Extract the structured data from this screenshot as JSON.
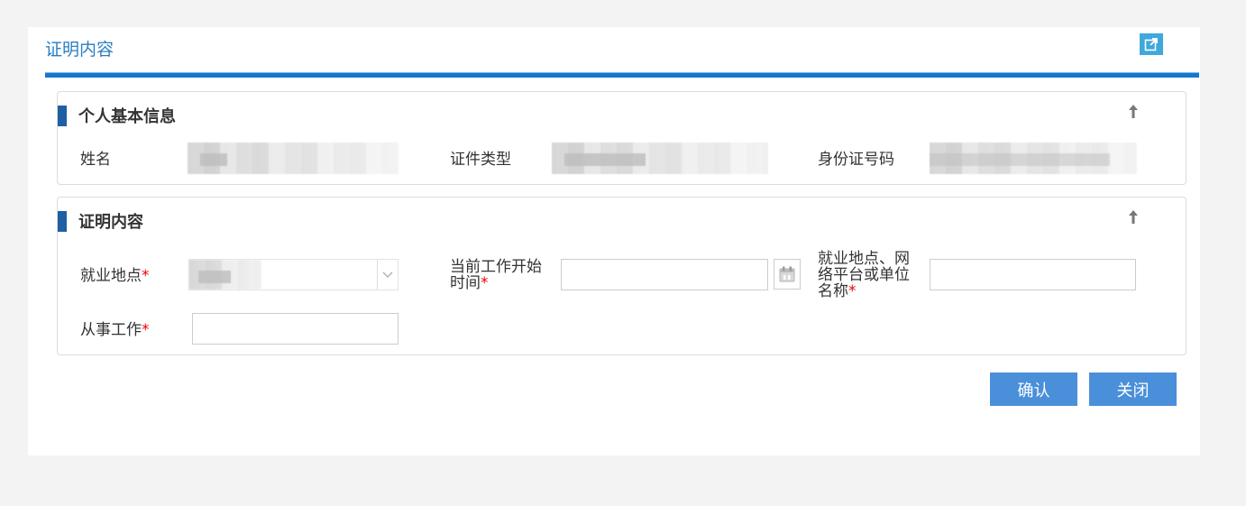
{
  "window": {
    "title": "证明内容"
  },
  "section_personal": {
    "title": "个人基本信息",
    "fields": {
      "name_label": "姓名",
      "id_type_label": "证件类型",
      "id_number_label": "身份证号码"
    }
  },
  "section_proof": {
    "title": "证明内容",
    "fields": {
      "location_label": "就业地点",
      "start_time_label_line1": "当前工作开始",
      "start_time_label_line2": "时间",
      "platform_label_line1": "就业地点、网",
      "platform_label_line2": "络平台或单位",
      "platform_label_line3": "名称",
      "job_label": "从事工作",
      "required_mark": "*"
    }
  },
  "buttons": {
    "confirm": "确认",
    "close": "关闭"
  },
  "colors": {
    "accent": "#2a7fc1",
    "rule": "#1677cc",
    "button": "#4a8fd9",
    "section_bar": "#1f5fa3",
    "required": "#e00000"
  }
}
